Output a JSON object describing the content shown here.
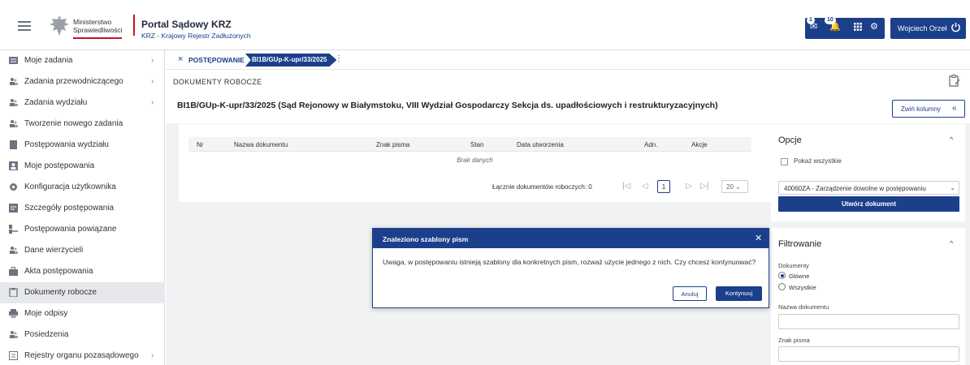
{
  "header": {
    "ministry_line1": "Ministerstwo",
    "ministry_line2": "Sprawiedliwości",
    "portal_title": "Portal Sądowy KRZ",
    "portal_subtitle": "KRZ - Krajowy Rejestr Zadłużonych",
    "messages_badge": "1",
    "notifications_badge": "10",
    "user_name": "Wojciech Orzeł"
  },
  "sidebar": {
    "items": [
      {
        "label": "Moje zadania",
        "icon": "tasks-icon"
      },
      {
        "label": "Zadania przewodniczącego",
        "icon": "users-icon"
      },
      {
        "label": "Zadania wydziału",
        "icon": "users-icon"
      },
      {
        "label": "Tworzenie nowego zadania",
        "icon": "users-icon"
      },
      {
        "label": "Postępowania wydziału",
        "icon": "folder-icon"
      },
      {
        "label": "Moje postępowania",
        "icon": "folder-user-icon"
      },
      {
        "label": "Konfiguracja użytkownika",
        "icon": "gear-icon"
      },
      {
        "label": "Szczegóły postępowania",
        "icon": "details-icon"
      },
      {
        "label": "Postępowania powiązane",
        "icon": "link-icon"
      },
      {
        "label": "Dane wierzycieli",
        "icon": "users-icon"
      },
      {
        "label": "Akta postępowania",
        "icon": "briefcase-icon"
      },
      {
        "label": "Dokumenty robocze",
        "icon": "clipboard-icon"
      },
      {
        "label": "Moje odpisy",
        "icon": "print-icon"
      },
      {
        "label": "Posiedzenia",
        "icon": "users-icon"
      },
      {
        "label": "Rejestry organu pozasądowego",
        "icon": "register-icon"
      }
    ]
  },
  "breadcrumb": {
    "first": "POSTĘPOWANIE",
    "second": "BI1B/GUp-K-upr/33/2025"
  },
  "page": {
    "title": "DOKUMENTY ROBOCZE",
    "case_title": "BI1B/GUp-K-upr/33/2025 (Sąd Rejonowy w Białymstoku, VIII Wydział Gospodarczy Sekcja ds. upadłościowych i restrukturyzacyjnych)",
    "columns_button": "Zwiń kolumny"
  },
  "table": {
    "headers": [
      "Nr",
      "Nazwa dokumentu",
      "Znak pisma",
      "Stan",
      "Data utworzenia",
      "Adn.",
      "Akcje"
    ],
    "empty_text": "Brak danych",
    "summary": "Łącznie dokumentów roboczych: 0",
    "page": "1",
    "page_size": "20"
  },
  "options": {
    "title": "Opcje",
    "show_all_label": "Pokaż wszystkie",
    "template_select": "40060ZA - Zarządzenie dowolne w postępowaniu",
    "create_button": "Utwórz dokument"
  },
  "filters": {
    "title": "Filtrowanie",
    "documents_label": "Dokumenty",
    "radio_main": "Główne",
    "radio_all": "Wszystkie",
    "name_label": "Nazwa dokumentu",
    "sign_label": "Znak pisma"
  },
  "modal": {
    "title": "Znaleziono szablony pism",
    "body": "Uwaga, w postępowaniu istnieją szablony dla konkretnych pism, rozważ użycie jednego z nich. Czy chcesz kontynuować?",
    "cancel": "Anuluj",
    "ok": "Kontynuuj"
  },
  "colors": {
    "primary": "#1b3f8b",
    "accent_red": "#c8102e",
    "background": "#f1f2f4"
  }
}
